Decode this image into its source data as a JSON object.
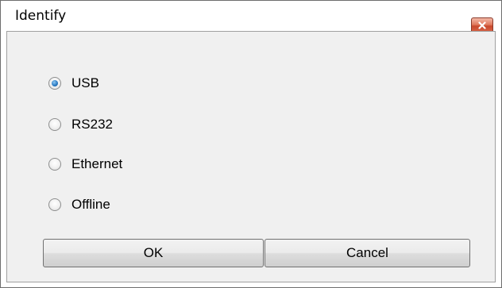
{
  "window": {
    "title": "Identify",
    "close_icon": "close-icon"
  },
  "connection_options": [
    {
      "label": "USB",
      "checked": true
    },
    {
      "label": "RS232",
      "checked": false
    },
    {
      "label": "Ethernet",
      "checked": false
    },
    {
      "label": "Offline",
      "checked": false
    }
  ],
  "buttons": {
    "ok_label": "OK",
    "cancel_label": "Cancel"
  },
  "colors": {
    "close_button": "#d8674a",
    "radio_selected": "#2c7cc4"
  }
}
